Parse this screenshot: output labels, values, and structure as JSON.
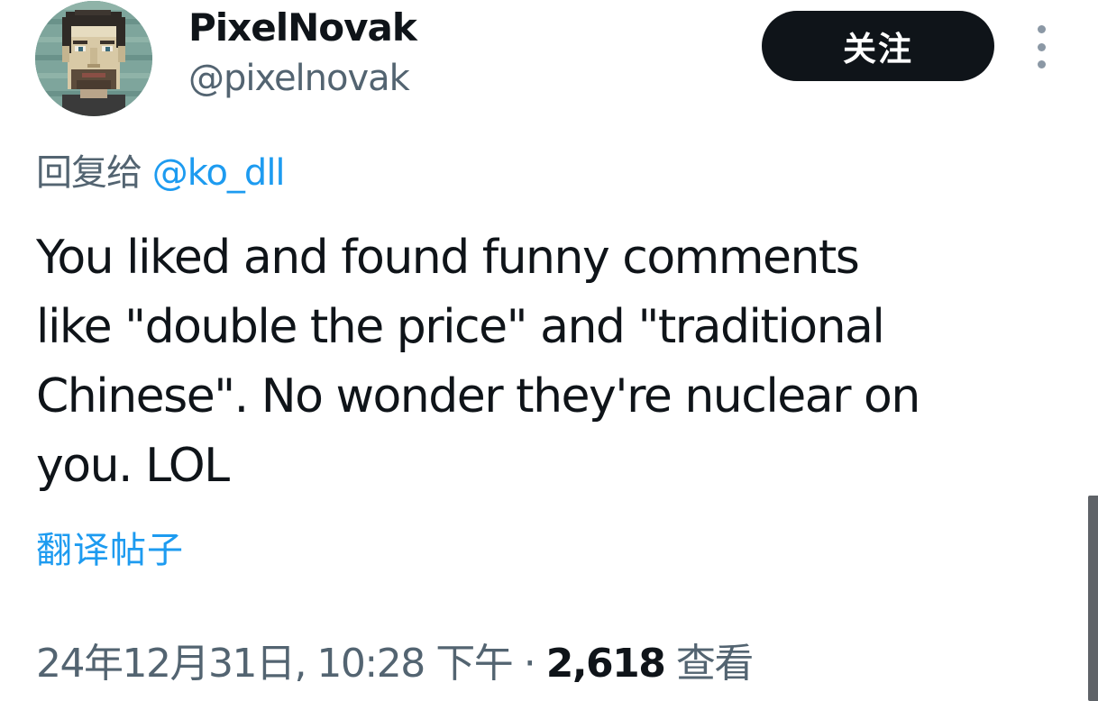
{
  "author": {
    "display_name": "PixelNovak",
    "handle": "@pixelnovak",
    "avatar_icon": "pixel-art-portrait-avatar"
  },
  "follow_button": {
    "label": "关注"
  },
  "more_button": {
    "icon": "vertical-ellipsis-icon"
  },
  "reply": {
    "prefix": "回复给",
    "mention": "@ko_dll"
  },
  "tweet": {
    "text": "You liked and found funny comments\nlike \"double the price\" and \"traditional\nChinese\". No wonder they're nuclear on\nyou. LOL"
  },
  "translate_link": {
    "label": "翻译帖子"
  },
  "meta": {
    "timestamp": "24年12月31日, 10:28 下午",
    "separator": " · ",
    "views_count": "2,618",
    "views_label": "查看"
  },
  "colors": {
    "text_primary": "#0f1419",
    "text_secondary": "#536471",
    "link": "#1d9bf0",
    "button_bg": "#0f1419",
    "button_text": "#ffffff"
  }
}
